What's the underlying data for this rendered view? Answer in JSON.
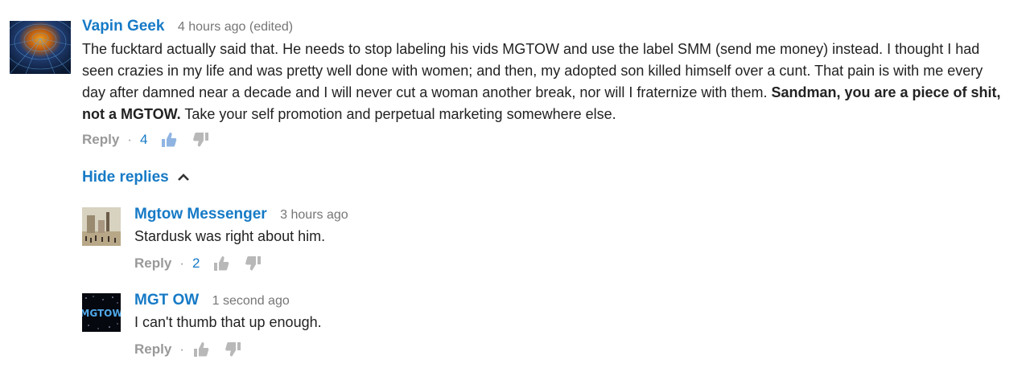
{
  "colors": {
    "link": "#167ac6",
    "muted": "#767676",
    "text": "#222222"
  },
  "comments": [
    {
      "author": "Vapin Geek",
      "time": "4 hours ago (edited)",
      "text_part1": "The fucktard actually said that.  He needs to stop labeling his vids MGTOW and use the label SMM (send me money) instead.  I thought I had seen crazies in my life  and was pretty well done with women; and then, my adopted son killed himself over a cunt.  That pain is with me every day after damned near a decade and I will never cut a woman another break, nor will I fraternize with them.  ",
      "text_bold": "Sandman, you are a piece of shit, not a MGTOW.",
      "text_part2": "  Take your self promotion and perpetual marketing somewhere else.",
      "reply_label": "Reply",
      "dot": "·",
      "likes": "4"
    }
  ],
  "hide_replies_label": "Hide replies",
  "replies": [
    {
      "author": "Mgtow Messenger",
      "time": "3 hours ago",
      "text": "Stardusk was right about him.",
      "reply_label": "Reply",
      "dot": "·",
      "likes": "2"
    },
    {
      "author": "MGT OW",
      "time": "1 second ago",
      "text": "I can't thumb that up enough.",
      "reply_label": "Reply",
      "dot": "·",
      "avatar_text": "MGTOW"
    }
  ]
}
